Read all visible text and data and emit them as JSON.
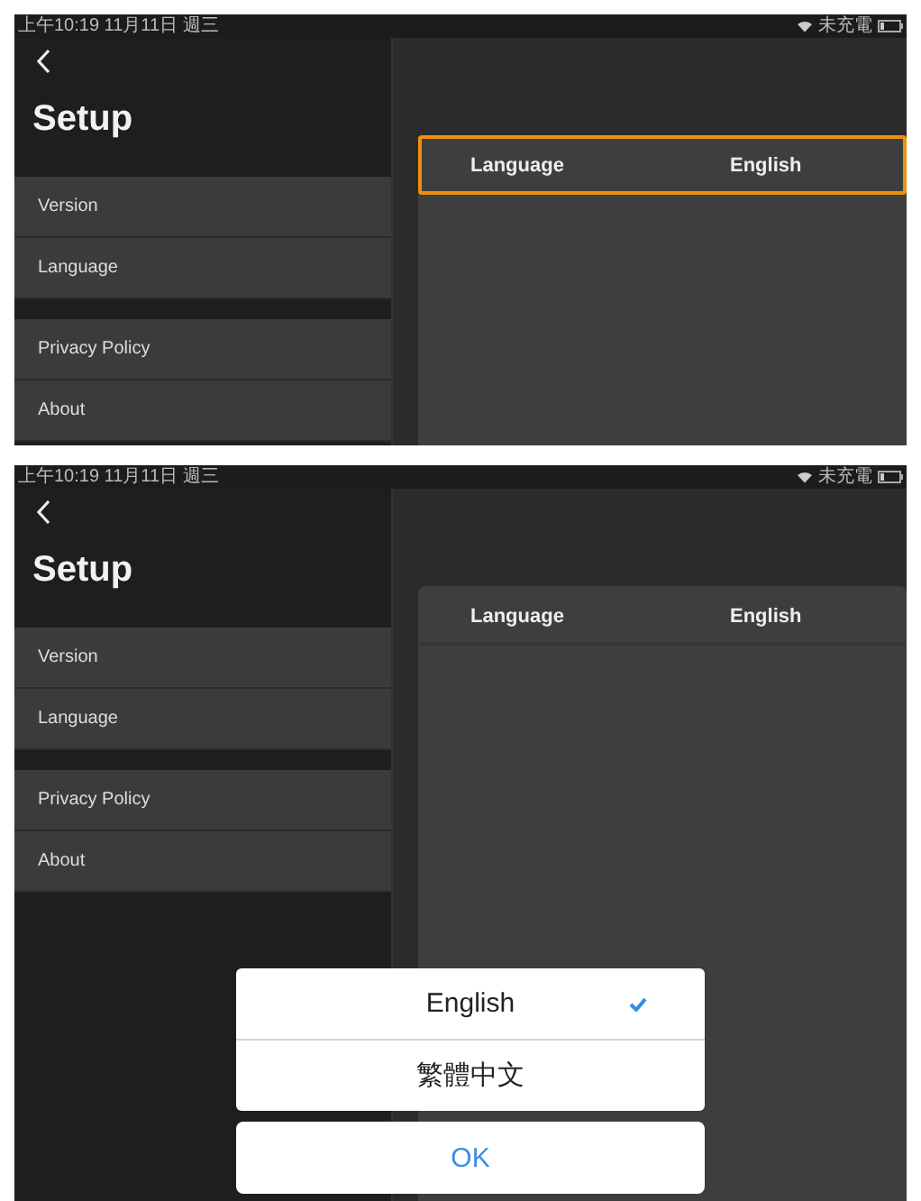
{
  "screens": [
    {
      "status_bar": {
        "time": "上午10:19  11月11日 週三",
        "battery_text": "未充電"
      },
      "title": "Setup",
      "menu_sections": [
        [
          "Version",
          "Language"
        ],
        [
          "Privacy Policy",
          "About"
        ]
      ],
      "detail_row": {
        "label": "Language",
        "value": "English",
        "highlighted": true
      }
    },
    {
      "status_bar": {
        "time": "上午10:19  11月11日 週三",
        "battery_text": "未充電"
      },
      "title": "Setup",
      "menu_sections": [
        [
          "Version",
          "Language"
        ],
        [
          "Privacy Policy",
          "About"
        ]
      ],
      "detail_row": {
        "label": "Language",
        "value": "English",
        "highlighted": false
      },
      "picker": {
        "options": [
          {
            "label": "English",
            "selected": true
          },
          {
            "label": "繁體中文",
            "selected": false
          }
        ],
        "button": "OK"
      }
    }
  ]
}
